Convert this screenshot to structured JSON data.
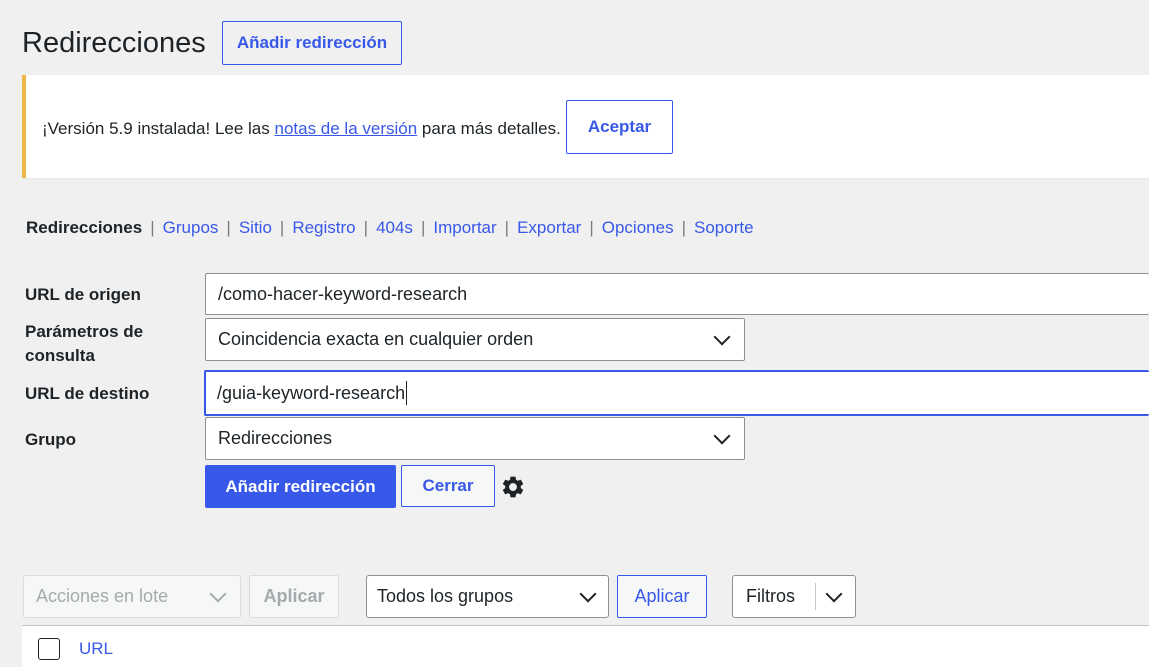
{
  "header": {
    "title": "Redirecciones",
    "add_button": "Añadir redirección"
  },
  "notice": {
    "text_before": "¡Versión 5.9 instalada! Lee las ",
    "link": "notas de la versión",
    "text_after": " para más detalles.",
    "accept_button": "Aceptar",
    "border_color": "#f0b849"
  },
  "subnav": {
    "items": [
      "Redirecciones",
      "Grupos",
      "Sitio",
      "Registro",
      "404s",
      "Importar",
      "Exportar",
      "Opciones",
      "Soporte"
    ],
    "separator": "|"
  },
  "form": {
    "source_label": "URL de origen",
    "source_value": "/como-hacer-keyword-research",
    "query_label": "Parámetros de consulta",
    "query_value": "Coincidencia exacta en cualquier orden",
    "target_label": "URL de destino",
    "target_value": "/guia-keyword-research",
    "group_label": "Grupo",
    "group_value": "Redirecciones",
    "submit_button": "Añadir redirección",
    "close_button": "Cerrar",
    "settings_icon": "gear-icon"
  },
  "bulk": {
    "actions_placeholder": "Acciones en lote",
    "apply_disabled": "Aplicar",
    "groups_value": "Todos los grupos",
    "apply": "Aplicar",
    "filters": "Filtros"
  },
  "table": {
    "column_url": "URL"
  },
  "colors": {
    "accent": "#3858e9",
    "background": "#f0f0f1"
  }
}
